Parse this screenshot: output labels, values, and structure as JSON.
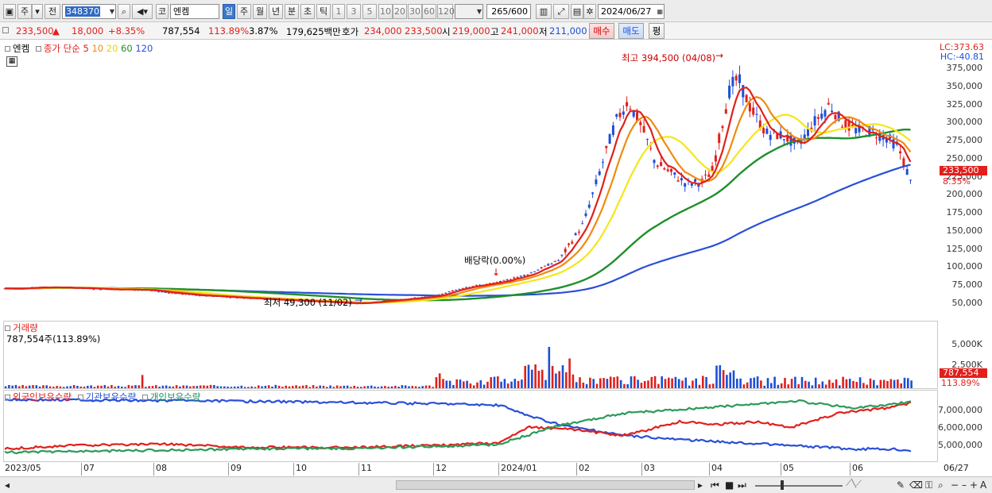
{
  "toolbar": {
    "market_label": "주",
    "prev_label": "전",
    "code": "348370",
    "market2_label": "코",
    "name": "엔켐",
    "periods": [
      "일",
      "주",
      "월",
      "년",
      "분",
      "초",
      "틱"
    ],
    "numbers": [
      "1",
      "3",
      "5",
      "10",
      "20",
      "30",
      "60",
      "120"
    ],
    "count": "265",
    "count_total": "/600",
    "date": "2024/06/27"
  },
  "quote": {
    "price": "233,500",
    "change": "18,000",
    "rate": "+8.35%",
    "volume": "787,554",
    "vol_ratio": "113.89%",
    "turnover_rate": "3.87%",
    "amount": "179,625백만",
    "ask_label": "호가",
    "ask": "234,000",
    "bid": "233,500",
    "open_label": "시",
    "open": "219,000",
    "high_label": "고",
    "high": "241,000",
    "low_label": "저",
    "low": "211,000",
    "buy_label": "매수",
    "sell_label": "매도",
    "eval_label": "평"
  },
  "price_pane": {
    "legend_name": "엔켐",
    "legend_ma": "종가 단순",
    "ma_periods": [
      "5",
      "10",
      "20",
      "60",
      "120"
    ],
    "ma_colors": [
      "#e0201c",
      "#f08a10",
      "#f5e61a",
      "#1f8f2c",
      "#2a4fd8"
    ],
    "lc": "LC:373.63",
    "hc": "HC:-40.81",
    "current_tag": "233,500",
    "current_rate": "8.35%",
    "high_annot": "최고 394,500 (04/08)",
    "low_annot": "최저 49,300 (11/02)",
    "dividend_annot": "배당락(0.00%)",
    "y_ticks": [
      "375,000",
      "350,000",
      "325,000",
      "300,000",
      "275,000",
      "250,000",
      "225,000",
      "200,000",
      "175,000",
      "150,000",
      "125,000",
      "100,000",
      "75,000",
      "50,000"
    ]
  },
  "volume_pane": {
    "title": "거래량",
    "value": "787,554주(113.89%)",
    "y_ticks": [
      "5,000K",
      "2,500K"
    ],
    "tag": "787,554",
    "tag_rate": "113.89%"
  },
  "holding_pane": {
    "legend": [
      "외국인보유수량",
      "기관보유수량",
      "개인보유수량"
    ],
    "y_ticks": [
      "7,000,000",
      "6,000,000",
      "5,000,000"
    ]
  },
  "x_axis": [
    "2023/05",
    "07",
    "08",
    "09",
    "10",
    "11",
    "12",
    "2024/01",
    "02",
    "03",
    "04",
    "05",
    "06",
    "06/27"
  ],
  "chart_data": {
    "type": "candlestick",
    "ylim": [
      40000,
      400000
    ],
    "high": {
      "value": 394500,
      "date": "04/08"
    },
    "low": {
      "value": 49300,
      "date": "11/02"
    },
    "last_close": 233500,
    "monthly_close_approx": [
      {
        "x": "2023/05",
        "y": 70000
      },
      {
        "x": "07",
        "y": 70000
      },
      {
        "x": "08",
        "y": 62000
      },
      {
        "x": "09",
        "y": 55000
      },
      {
        "x": "10",
        "y": 52000
      },
      {
        "x": "11",
        "y": 55000
      },
      {
        "x": "12",
        "y": 75000
      },
      {
        "x": "2024/01",
        "y": 105000
      },
      {
        "x": "02",
        "y": 230000
      },
      {
        "x": "03",
        "y": 230000
      },
      {
        "x": "04",
        "y": 320000
      },
      {
        "x": "05",
        "y": 280000
      },
      {
        "x": "06",
        "y": 270000
      },
      {
        "x": "06/27",
        "y": 233500
      }
    ]
  }
}
